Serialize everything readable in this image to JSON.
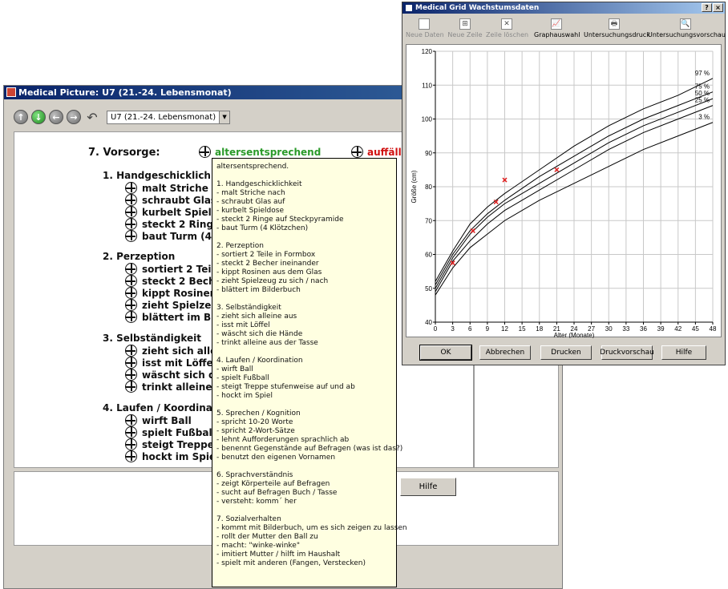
{
  "back_window": {
    "title": "Medical Picture: U7 (21.-24. Lebensmonat)",
    "exam_select": "U7 (21.-24. Lebensmonat)",
    "heading": "7. Vorsorge:",
    "option_ok": "altersentsprechend",
    "option_bad": "auffällig",
    "sections": [
      {
        "title": "1. Handgeschicklichke",
        "items": [
          "malt Striche nac",
          "schraubt Glas a",
          "kurbelt Spieldos",
          "steckt 2 Ringe a",
          "baut Turm (4 Klö"
        ]
      },
      {
        "title": "2. Perzeption",
        "items": [
          "sortiert 2 Teile in",
          "steckt 2 Becher",
          "kippt Rosinen au",
          "zieht Spielzeug",
          "blättert im Bilder"
        ]
      },
      {
        "title": "3. Selbständigkeit",
        "items": [
          "zieht sich alleine",
          "isst mit Löffel",
          "wäscht sich die",
          "trinkt alleine aus"
        ]
      },
      {
        "title": "4. Laufen / Koordinatio",
        "items": [
          "wirft Ball",
          "spielt Fußball",
          "steigt Treppe st",
          "hockt im Spiel"
        ]
      }
    ],
    "help_button": "Hilfe"
  },
  "tooltip": {
    "head": "altersentsprechend.",
    "groups": [
      [
        "1. Handgeschicklichkeit",
        " - malt Striche nach",
        " - schraubt Glas auf",
        " - kurbelt Spieldose",
        " - steckt 2 Ringe auf Steckpyramide",
        " - baut Turm (4 Klötzchen)"
      ],
      [
        "2. Perzeption",
        " - sortiert 2 Teile in Formbox",
        " - steckt 2 Becher ineinander",
        " - kippt Rosinen aus dem Glas",
        " - zieht Spielzeug zu sich / nach",
        " - blättert im Bilderbuch"
      ],
      [
        "3. Selbständigkeit",
        " - zieht sich alleine aus",
        " - isst mit Löffel",
        " - wäscht sich die Hände",
        " - trinkt alleine aus der Tasse"
      ],
      [
        "4. Laufen / Koordination",
        " - wirft Ball",
        " - spielt Fußball",
        " - steigt Treppe stufenweise auf und ab",
        " - hockt im Spiel"
      ],
      [
        "5. Sprechen / Kognition",
        " - spricht 10-20 Worte",
        " - spricht 2-Wort-Sätze",
        " - lehnt Aufforderungen sprachlich ab",
        " - benennt Gegenstände auf Befragen (was ist das?)",
        " - benutzt den eigenen Vornamen"
      ],
      [
        "6. Sprachverständnis",
        " - zeigt Körperteile auf Befragen",
        " - sucht auf Befragen Buch / Tasse",
        " - versteht: komm´ her"
      ],
      [
        "7. Sozialverhalten",
        " - kommt mit Bilderbuch, um es sich zeigen zu lassen",
        " - rollt der Mutter den Ball zu",
        " - macht: \"winke-winke\"",
        " - imitiert Mutter / hilft im Haushalt",
        " - spielt mit anderen (Fangen, Verstecken)"
      ]
    ]
  },
  "front_window": {
    "title": "Medical Grid Wachstumsdaten",
    "toolbar": [
      {
        "label": "Neue Daten",
        "icon": "new-data-icon",
        "glyph": "",
        "disabled": true
      },
      {
        "label": "Neue Zeile",
        "icon": "new-row-icon",
        "glyph": "⊞",
        "disabled": true
      },
      {
        "label": "Zeile löschen",
        "icon": "delete-row-icon",
        "glyph": "✕",
        "disabled": true
      },
      {
        "label": "Graphauswahl",
        "icon": "graph-select-icon",
        "glyph": "📈",
        "disabled": false
      },
      {
        "label": "Untersuchungsdruck",
        "icon": "printer-icon",
        "glyph": "🖶",
        "disabled": false
      },
      {
        "label": "Untersuchungsvorschau",
        "icon": "preview-icon",
        "glyph": "🔍",
        "disabled": false
      }
    ],
    "buttons": [
      "OK",
      "Abbrechen",
      "Drucken",
      "Druckvorschau",
      "Hilfe"
    ]
  },
  "chart_data": {
    "type": "line",
    "title": "",
    "xlabel": "Alter (Monate)",
    "ylabel": "Größe (cm)",
    "xlim": [
      0,
      48
    ],
    "ylim": [
      40,
      120
    ],
    "xticks": [
      0,
      3,
      6,
      9,
      12,
      15,
      18,
      21,
      24,
      27,
      30,
      33,
      36,
      39,
      42,
      45,
      48
    ],
    "yticks": [
      40,
      50,
      60,
      70,
      80,
      90,
      100,
      110,
      120
    ],
    "grid": true,
    "series": [
      {
        "name": "97 %",
        "x": [
          0,
          3,
          6,
          9,
          12,
          18,
          24,
          30,
          36,
          42,
          48
        ],
        "values": [
          52,
          61,
          69,
          74,
          78,
          85,
          92,
          98,
          103,
          107,
          112
        ]
      },
      {
        "name": "75 %",
        "x": [
          0,
          3,
          6,
          9,
          12,
          18,
          24,
          30,
          36,
          42,
          48
        ],
        "values": [
          51,
          60,
          67,
          72,
          76,
          83,
          89,
          95,
          100,
          104,
          108
        ]
      },
      {
        "name": "50 %",
        "x": [
          0,
          3,
          6,
          9,
          12,
          18,
          24,
          30,
          36,
          42,
          48
        ],
        "values": [
          50,
          59,
          66,
          71,
          75,
          81,
          87,
          93,
          98,
          102,
          106
        ]
      },
      {
        "name": "25 %",
        "x": [
          0,
          3,
          6,
          9,
          12,
          18,
          24,
          30,
          36,
          42,
          48
        ],
        "values": [
          49,
          58,
          64,
          69,
          73,
          79,
          85,
          91,
          96,
          100,
          104
        ]
      },
      {
        "name": "3 %",
        "x": [
          0,
          3,
          6,
          9,
          12,
          18,
          24,
          30,
          36,
          42,
          48
        ],
        "values": [
          48,
          56,
          62,
          66,
          70,
          76,
          81,
          86,
          91,
          95,
          99
        ]
      }
    ],
    "measurements": {
      "x": [
        3,
        6.5,
        10.5,
        12,
        21
      ],
      "y": [
        57.5,
        67,
        75.5,
        82,
        85
      ]
    },
    "colors": {
      "curves": "#000000",
      "grid": "#c8c8c8",
      "points": "#e02020"
    }
  }
}
